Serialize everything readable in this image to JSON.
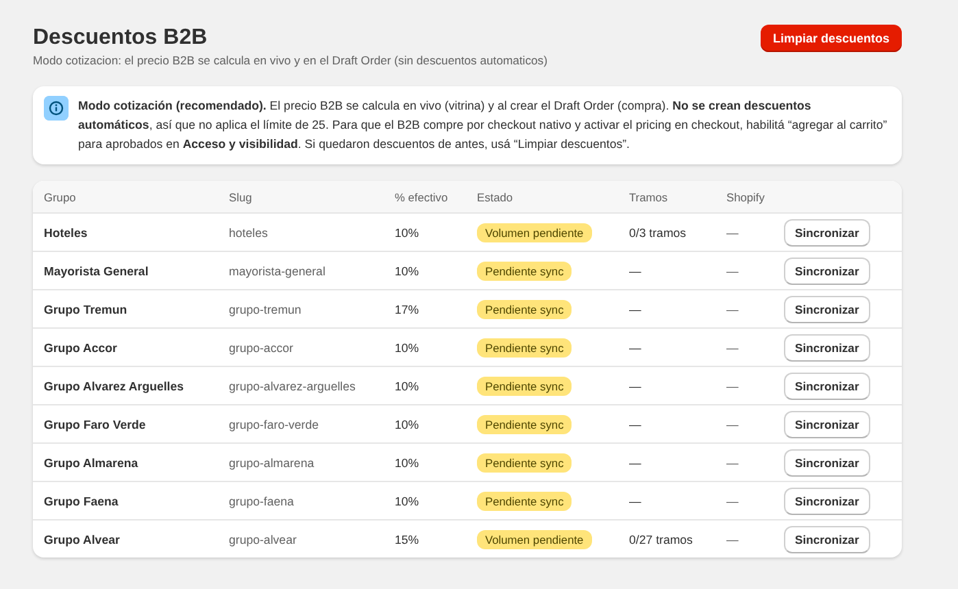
{
  "header": {
    "title": "Descuentos B2B",
    "subtitle": "Modo cotizacion: el precio B2B se calcula en vivo y en el Draft Order (sin descuentos automaticos)",
    "action": "Limpiar descuentos"
  },
  "banner": {
    "text": "**Modo cotización (recomendado).** El precio B2B se calcula en vivo (vitrina) y al crear el Draft Order (compra). **No se crean descuentos automáticos**, así que no aplica el límite de 25. Para que el B2B compre por checkout nativo y activar el pricing en checkout, habilitá “agregar al carrito” para aprobados en **Acceso y visibilidad**. Si quedaron descuentos de antes, usá “Limpiar descuentos”."
  },
  "table": {
    "columns": [
      "Grupo",
      "Slug",
      "% efectivo",
      "Estado",
      "Tramos",
      "Shopify"
    ],
    "rows": [
      {
        "grupo": "Hoteles",
        "slug": "hoteles",
        "efectivo": "10%",
        "estado": "Volumen pendiente",
        "tramos": "0/3 tramos",
        "shopify": "—",
        "action": "Sincronizar"
      },
      {
        "grupo": "Mayorista General",
        "slug": "mayorista-general",
        "efectivo": "10%",
        "estado": "Pendiente sync",
        "tramos": "—",
        "shopify": "—",
        "action": "Sincronizar"
      },
      {
        "grupo": "Grupo Tremun",
        "slug": "grupo-tremun",
        "efectivo": "17%",
        "estado": "Pendiente sync",
        "tramos": "—",
        "shopify": "—",
        "action": "Sincronizar"
      },
      {
        "grupo": "Grupo Accor",
        "slug": "grupo-accor",
        "efectivo": "10%",
        "estado": "Pendiente sync",
        "tramos": "—",
        "shopify": "—",
        "action": "Sincronizar"
      },
      {
        "grupo": "Grupo Alvarez Arguelles",
        "slug": "grupo-alvarez-arguelles",
        "efectivo": "10%",
        "estado": "Pendiente sync",
        "tramos": "—",
        "shopify": "—",
        "action": "Sincronizar"
      },
      {
        "grupo": "Grupo Faro Verde",
        "slug": "grupo-faro-verde",
        "efectivo": "10%",
        "estado": "Pendiente sync",
        "tramos": "—",
        "shopify": "—",
        "action": "Sincronizar"
      },
      {
        "grupo": "Grupo Almarena",
        "slug": "grupo-almarena",
        "efectivo": "10%",
        "estado": "Pendiente sync",
        "tramos": "—",
        "shopify": "—",
        "action": "Sincronizar"
      },
      {
        "grupo": "Grupo Faena",
        "slug": "grupo-faena",
        "efectivo": "10%",
        "estado": "Pendiente sync",
        "tramos": "—",
        "shopify": "—",
        "action": "Sincronizar"
      },
      {
        "grupo": "Grupo Alvear",
        "slug": "grupo-alvear",
        "efectivo": "15%",
        "estado": "Volumen pendiente",
        "tramos": "0/27 tramos",
        "shopify": "—",
        "action": "Sincronizar"
      }
    ]
  }
}
